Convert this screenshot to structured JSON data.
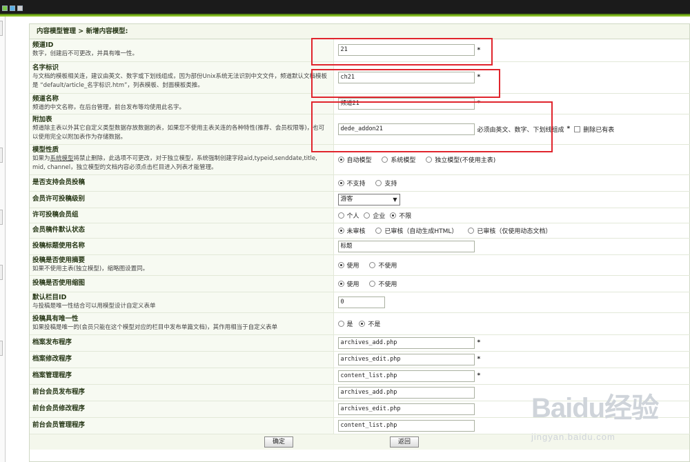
{
  "breadcrumb": "内容模型管理 > 新增内容模型:",
  "rows": [
    {
      "title": "频道ID",
      "desc": "数字，创建后不可更改，并具有唯一性。",
      "value": "21",
      "required": "*"
    },
    {
      "title": "名字标识",
      "desc": "与文档的模板相关连，建议由英文、数字或下划线组成，因为部份Unix系统无法识别中文文件，频道默认文档模板是 “default/article_名字标识.htm”，列表模板、封面模板类推。",
      "value": "ch21",
      "required": "*"
    },
    {
      "title": "频道名称",
      "desc": "频道的中文名称，在后台管理，前台发布等均使用此名字。",
      "value": "频道21",
      "required": "*"
    },
    {
      "title": "附加表",
      "desc": "频道除主表以外其它自定义类型数据存放数据的表，如果您不使用主表关连的各种特性(推荐、会员权限等)，也可以使用完全以附加表作为存储数据。",
      "value": "dede_addon21",
      "note": "必须由英文、数字、下划线组成",
      "required": "*",
      "checkbox_label": "删除已有表"
    },
    {
      "title": "模型性质",
      "desc_a": "如果为",
      "desc_link": "系统模型",
      "desc_b": "将禁止删除，此选项不可更改，对于独立模型，系统强制创建字段aid,typeid,senddate,title, mid, channel，独立模型的文档内容必须点击栏目进入列表才能管理。",
      "options": [
        "自动模型",
        "系统模型",
        "独立模型(不使用主表)"
      ],
      "selected": "自动模型"
    },
    {
      "title": "是否支持会员投稿",
      "options": [
        "不支持",
        "支持"
      ],
      "selected": "不支持"
    },
    {
      "title": "会员许可投稿级别",
      "select_value": "游客"
    },
    {
      "title": "许可投稿会员组",
      "options": [
        "个人",
        "企业",
        "不限"
      ],
      "selected": "不限"
    },
    {
      "title": "会员稿件默认状态",
      "options": [
        "未审核",
        "已审核（自动生成HTML）",
        "已审核（仅使用动态文档）"
      ],
      "selected": "未审核"
    },
    {
      "title": "投稿标题使用名称",
      "value": "标题"
    },
    {
      "title": "投稿是否使用摘要",
      "desc": "如果不使用主表(独立模型)，缩略图设置同。",
      "options": [
        "使用",
        "不使用"
      ],
      "selected": "使用"
    },
    {
      "title": "投稿是否使用缩图",
      "options": [
        "使用",
        "不使用"
      ],
      "selected": "使用"
    },
    {
      "title": "默认栏目ID",
      "desc": "与投稿是唯一性结合可以用模型设计自定义表单",
      "value": "0"
    },
    {
      "title": "投稿具有唯一性",
      "desc": "如果投稿是唯一的(会员只能在这个模型对应的栏目中发布单篇文档)，其作用相当于自定义表单",
      "options": [
        "是",
        "不是"
      ],
      "selected": "不是"
    },
    {
      "title": "档案发布程序",
      "value": "archives_add.php",
      "required": "*"
    },
    {
      "title": "档案修改程序",
      "value": "archives_edit.php",
      "required": "*"
    },
    {
      "title": "档案管理程序",
      "value": "content_list.php",
      "required": "*"
    },
    {
      "title": "前台会员发布程序",
      "value": "archives_add.php"
    },
    {
      "title": "前台会员修改程序",
      "value": "archives_edit.php"
    },
    {
      "title": "前台会员管理程序",
      "value": "content_list.php"
    }
  ],
  "buttons": {
    "ok": "确定",
    "back": "返回"
  },
  "watermark": {
    "brand": "Baidu经验",
    "url": "jingyan.baidu.com"
  },
  "colors": {
    "accent": "#8fc32a",
    "highlight": "#e0242c",
    "label_bg": "#f7faf2"
  }
}
